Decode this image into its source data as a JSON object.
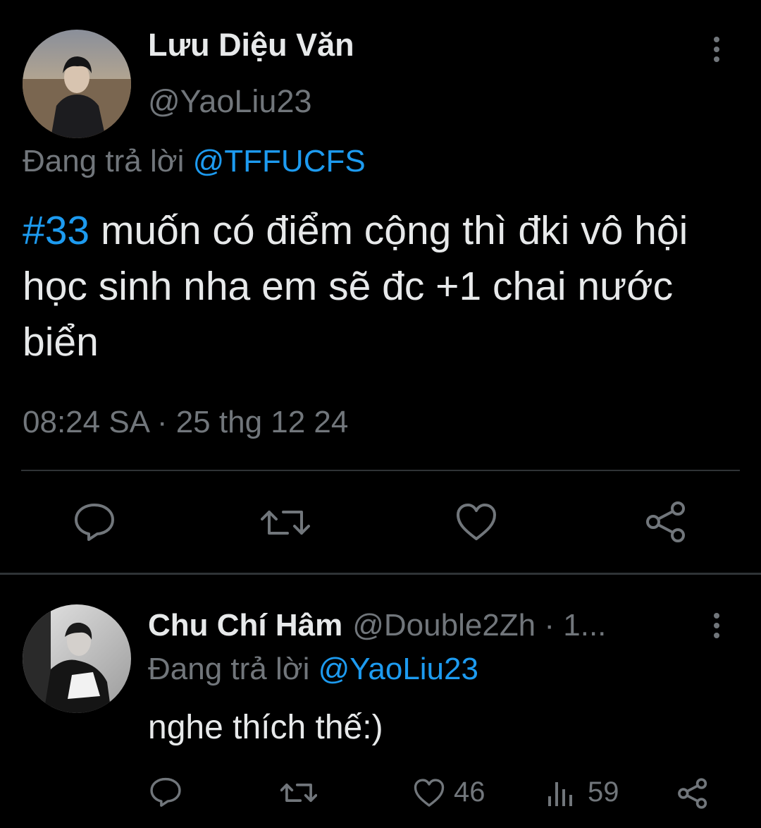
{
  "main_tweet": {
    "display_name": "Lưu Diệu Văn",
    "handle": "@YaoLiu23",
    "reply_prefix": "Đang trả lời ",
    "reply_to": "@TFFUCFS",
    "hashtag": "#33",
    "text": " muốn có điểm cộng thì đki vô hội học sinh nha em sẽ đc +1 chai nước biển",
    "timestamp": "08:24 SA · 25 thg 12 24",
    "actions": [
      "reply-icon",
      "retweet-icon",
      "like-icon",
      "share-icon"
    ]
  },
  "reply_tweet": {
    "display_name": "Chu Chí Hâm",
    "handle": "@Double2Zh · 1...",
    "reply_prefix": "Đang trả lời ",
    "reply_to": "@YaoLiu23",
    "text": "nghe thích thế:)",
    "like_count": "46",
    "view_count": "59",
    "actions": [
      "reply-icon",
      "retweet-icon",
      "like-icon",
      "views-icon",
      "share-icon"
    ]
  },
  "colors": {
    "background": "#000000",
    "text": "#e7e9ea",
    "muted": "#71767b",
    "accent": "#1d9bf0",
    "divider": "#2f3336"
  }
}
